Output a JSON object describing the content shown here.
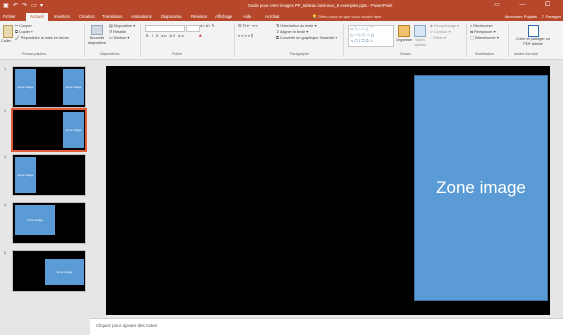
{
  "window": {
    "title": "Guide pour créer images PP_tableau lumineux_5 exemples.pptx - PowerPoint",
    "controls": "▭ — ⧠"
  },
  "tabs": [
    {
      "label": "Fichier"
    },
    {
      "label": "Accueil"
    },
    {
      "label": "Insertion"
    },
    {
      "label": "Création"
    },
    {
      "label": "Transitions"
    },
    {
      "label": "Animations"
    },
    {
      "label": "Diaporama"
    },
    {
      "label": "Révision"
    },
    {
      "label": "Affichage"
    },
    {
      "label": "Aide"
    },
    {
      "label": "Acrobat"
    }
  ],
  "tell_me": "Dites-nous ce que vous voulez faire",
  "user": "Alexandre Pujadis",
  "share": "Partager",
  "ribbon": {
    "clipboard": {
      "paste": "Coller",
      "cut": "Couper",
      "copy": "Copier",
      "format_painter": "Reproduire la mise en forme",
      "group": "Presse-papiers"
    },
    "slides": {
      "new_slide": "Nouvelle diapositive",
      "layout": "Disposition",
      "reset": "Rétablir",
      "section": "Section",
      "group": "Diapositives"
    },
    "font": {
      "format_row": "B I S ab AV Aa",
      "group": "Police"
    },
    "paragraph": {
      "text_direction": "Orientation du texte",
      "align_text": "Aligner le texte",
      "smartart": "Convertir en graphique SmartArt",
      "group": "Paragraphe"
    },
    "drawing": {
      "arrange": "Organiser",
      "quick_styles": "Styles rapides",
      "fill": "Remplissage",
      "outline": "Contour",
      "effects": "Effets",
      "group": "Dessin"
    },
    "editing": {
      "find": "Rechercher",
      "replace": "Remplacer",
      "select": "Sélectionner",
      "group": "Modification"
    },
    "adobe": {
      "share_pdf": "Créer et partager un PDF Adobe",
      "group": "Adobe Acrobat"
    }
  },
  "thumbnails": [
    {
      "number": "1",
      "boxes": [
        "Zone image",
        "Zone image"
      ]
    },
    {
      "number": "2",
      "boxes": [
        "Zone image"
      ]
    },
    {
      "number": "3",
      "boxes": [
        "Zone image"
      ]
    },
    {
      "number": "4",
      "boxes": [
        "Zone image"
      ]
    },
    {
      "number": "5",
      "boxes": [
        "Zone image"
      ]
    }
  ],
  "slide": {
    "zone_label": "Zone image"
  },
  "notes_placeholder": "Cliquez pour ajouter des notes",
  "colors": {
    "accent": "#b7472a",
    "placeholder_fill": "#5b9bd5",
    "selected_border": "#e35d3a"
  }
}
